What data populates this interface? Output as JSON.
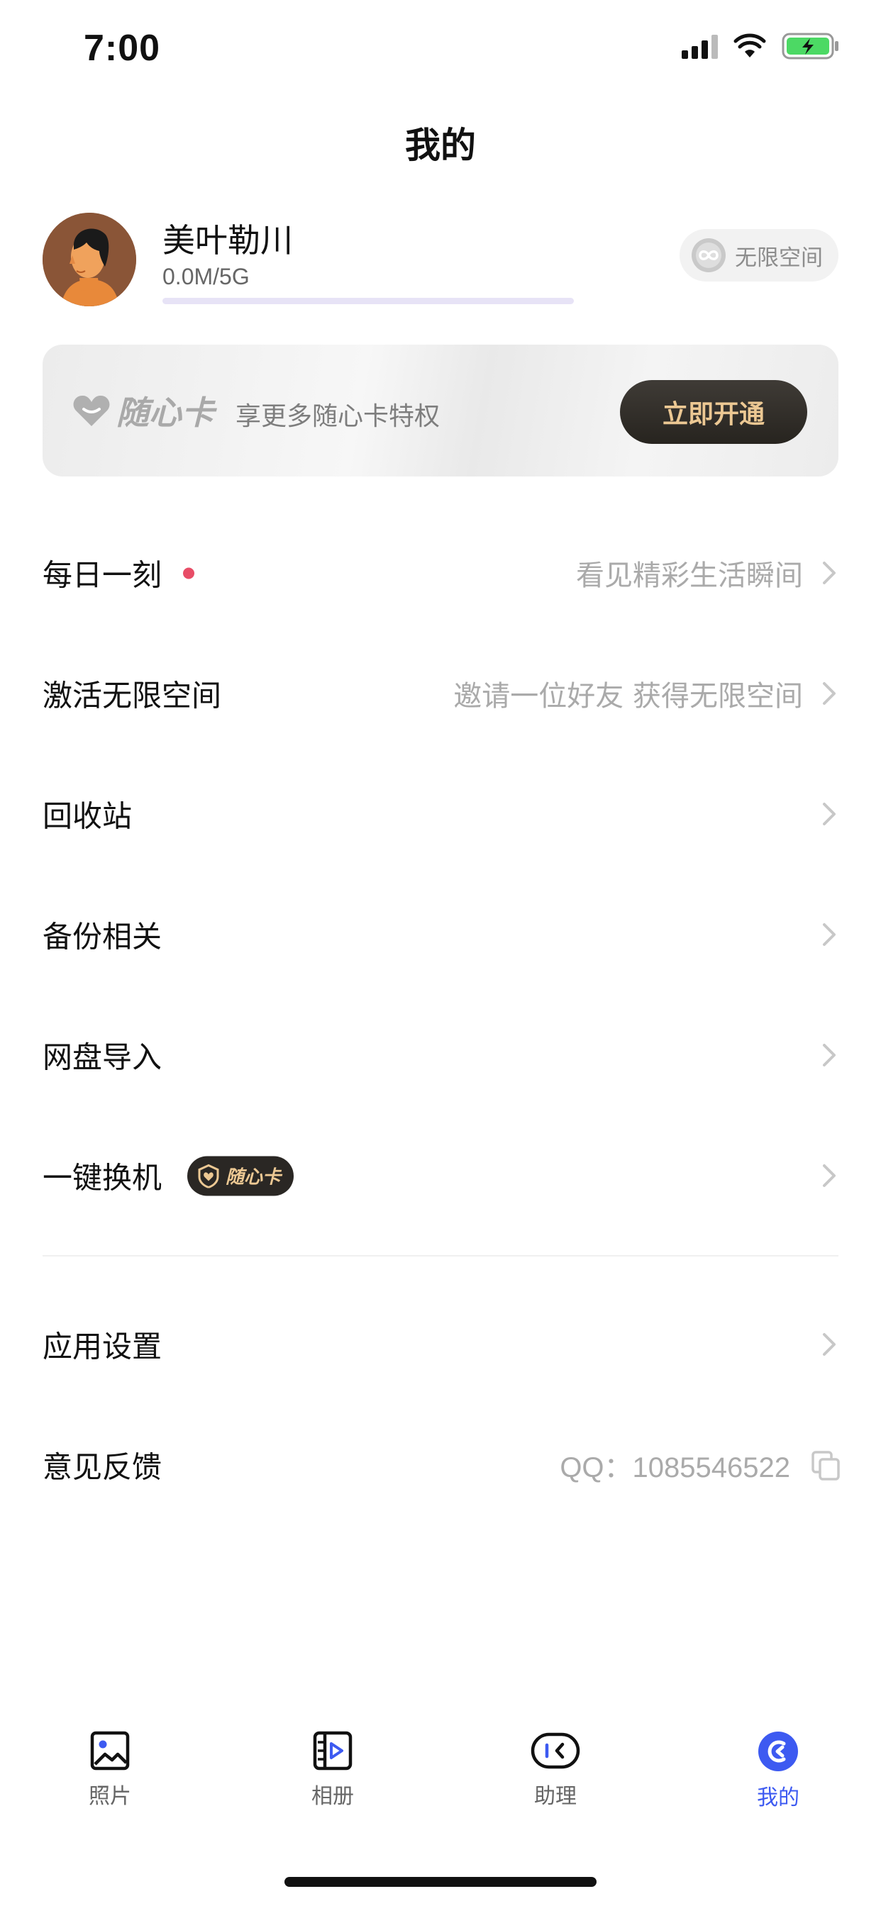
{
  "status_bar": {
    "time": "7:00"
  },
  "header": {
    "title": "我的"
  },
  "profile": {
    "name": "美叶勒川",
    "storage": "0.0M/5G",
    "storage_used_fraction": 0.0,
    "space_badge": "无限空间"
  },
  "vip_banner": {
    "logo_text": "随心卡",
    "slogan": "享更多随心卡特权",
    "button": "立即开通"
  },
  "menu": {
    "daily": {
      "label": "每日一刻",
      "desc": "看见精彩生活瞬间"
    },
    "activate": {
      "label": "激活无限空间",
      "desc": "邀请一位好友 获得无限空间"
    },
    "recycle": {
      "label": "回收站"
    },
    "backup": {
      "label": "备份相关"
    },
    "cloud_import": {
      "label": "网盘导入"
    },
    "phone_switch": {
      "label": "一键换机",
      "tag": "随心卡"
    },
    "settings": {
      "label": "应用设置"
    },
    "feedback": {
      "label": "意见反馈",
      "qq": "QQ：1085546522"
    }
  },
  "tabs": [
    {
      "label": "照片",
      "icon": "photo-icon"
    },
    {
      "label": "相册",
      "icon": "album-icon"
    },
    {
      "label": "助理",
      "icon": "assistant-icon"
    },
    {
      "label": "我的",
      "icon": "profile-icon"
    }
  ],
  "colors": {
    "accent": "#3d5af1",
    "dot": "#e84d67",
    "vip_gold": "#ecc893",
    "vip_dark": "#2a2724"
  }
}
